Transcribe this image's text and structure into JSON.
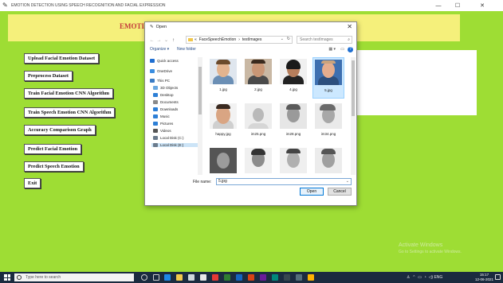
{
  "window": {
    "title": "EMOTION DETECTION USING SPEECH RECOGNITION AND FACIAL EXPRESSION",
    "minimize": "—",
    "maximize": "☐",
    "close": "✕"
  },
  "banner": {
    "heading": "EMOTION D"
  },
  "buttons": [
    "Upload Facial Emotion Dataset",
    "Preprocess Dataset",
    "Train Facial Emotion CNN Algorithm",
    "Train Speech Emotion CNN Algorithm",
    "Accuracy Comparison Graph",
    "Predict Facial Emotion",
    "Predict Speech Emotion",
    "Exit"
  ],
  "dialog": {
    "title": "Open",
    "close": "✕",
    "nav": {
      "back": "←",
      "forward": "→",
      "recent": "⌄",
      "up": "↑"
    },
    "path": [
      "FaceSpeechEmotion",
      "testImages"
    ],
    "path_prefix": "«",
    "path_sep": "›",
    "refresh": "↻",
    "search_placeholder": "Search testImages",
    "organize": "Organize ▾",
    "new_folder": "New folder",
    "help": "?",
    "nav_pane": [
      {
        "label": "Quick access",
        "icon": "star-icon",
        "color": "#1f6fd1"
      },
      {
        "label": "OneDrive",
        "icon": "cloud-icon",
        "color": "#3b8ee0"
      },
      {
        "label": "This PC",
        "icon": "computer-icon",
        "color": "#3b7cc4"
      },
      {
        "label": "3D Objects",
        "icon": "cube-icon",
        "color": "#6aa8e0"
      },
      {
        "label": "Desktop",
        "icon": "desktop-icon",
        "color": "#2d7fd6"
      },
      {
        "label": "Documents",
        "icon": "document-icon",
        "color": "#8a8a8a"
      },
      {
        "label": "Downloads",
        "icon": "download-icon",
        "color": "#2d7fd6"
      },
      {
        "label": "Music",
        "icon": "music-icon",
        "color": "#2d7fd6"
      },
      {
        "label": "Pictures",
        "icon": "picture-icon",
        "color": "#2d7fd6"
      },
      {
        "label": "Videos",
        "icon": "video-icon",
        "color": "#555555"
      },
      {
        "label": "Local Disk (C:)",
        "icon": "drive-icon",
        "color": "#6a7b8c"
      },
      {
        "label": "Local Disk (E:)",
        "icon": "drive-icon",
        "color": "#6a7b8c"
      }
    ],
    "selected_nav": "Local Disk (E:)",
    "files": [
      {
        "name": "1.jpg",
        "kind": "photo-color"
      },
      {
        "name": "2.jpg",
        "kind": "photo-color"
      },
      {
        "name": "4.jpg",
        "kind": "photo-dark"
      },
      {
        "name": "5.jpg",
        "kind": "photo-color"
      },
      {
        "name": "happy.jpg",
        "kind": "photo-color"
      },
      {
        "name": "im25.png",
        "kind": "photo-gray"
      },
      {
        "name": "im28.png",
        "kind": "photo-gray"
      },
      {
        "name": "im34.png",
        "kind": "photo-gray"
      },
      {
        "name": "",
        "kind": "photo-gray"
      },
      {
        "name": "",
        "kind": "photo-gray"
      },
      {
        "name": "",
        "kind": "photo-gray"
      },
      {
        "name": "",
        "kind": "photo-gray"
      }
    ],
    "selected_file": "5.jpg",
    "file_name_label": "File name:",
    "file_name_value": "5.jpg",
    "open_button": "Open",
    "cancel_button": "Cancel"
  },
  "watermark": {
    "line1": "Activate Windows",
    "line2": "Go to Settings to activate Windows."
  },
  "taskbar": {
    "search_placeholder": "Type here to search",
    "tray_text": "ENG",
    "time": "15:17",
    "date": "12-06-2021"
  },
  "colors": {
    "background": "#9edd34",
    "banner": "#f5f07b",
    "heading": "#c43c3c",
    "selection": "#cce8ff",
    "taskbar": "#1b2b3f"
  }
}
